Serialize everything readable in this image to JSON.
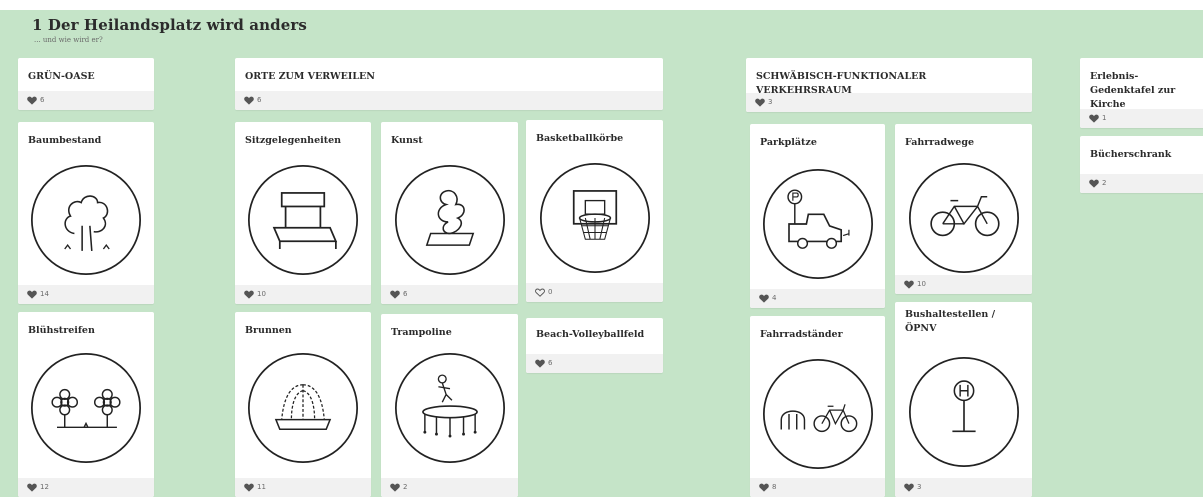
{
  "board": {
    "title": "1 Der Heilandsplatz wird anders",
    "subtitle": "... und wie wird er?"
  },
  "columns": {
    "gruen_oase": {
      "label": "GRÜN-OASE",
      "likes": "6"
    },
    "orte_zum_verweilen": {
      "label": "ORTE ZUM VERWEILEN",
      "likes": "6"
    },
    "verkehrsraum": {
      "label": "SCHWÄBISCH-FUNKTIONALER VERKEHRSRAUM",
      "likes": "3"
    },
    "erlebnis": {
      "label": "Erlebnis-Gedenktafel zur Kirche",
      "likes": "1"
    }
  },
  "cards": {
    "baumbestand": {
      "label": "Baumbestand",
      "likes": "14",
      "icon": "tree-icon"
    },
    "bluehstreifen": {
      "label": "Blühstreifen",
      "likes": "12",
      "icon": "flowers-icon"
    },
    "sitzgelegenheiten": {
      "label": "Sitzgelegenheiten",
      "likes": "10",
      "icon": "bench-icon"
    },
    "kunst": {
      "label": "Kunst",
      "likes": "6",
      "icon": "sculpture-icon"
    },
    "basketballkoerbe": {
      "label": "Basketballkörbe",
      "likes": "0",
      "icon": "basketball-hoop-icon"
    },
    "brunnen": {
      "label": "Brunnen",
      "likes": "11",
      "icon": "fountain-icon"
    },
    "trampoline": {
      "label": "Trampoline",
      "likes": "2",
      "icon": "trampoline-icon"
    },
    "beach_volleyballfeld": {
      "label": "Beach-Volleyballfeld",
      "likes": "6"
    },
    "parkplaetze": {
      "label": "Parkplätze",
      "likes": "4",
      "icon": "parking-car-icon"
    },
    "fahrradwege": {
      "label": "Fahrradwege",
      "likes": "10",
      "icon": "bicycle-icon"
    },
    "fahrradstaender": {
      "label": "Fahrradständer",
      "likes": "8",
      "icon": "bike-rack-icon"
    },
    "bushaltestellen": {
      "label": "Bushaltestellen / ÖPNV",
      "likes": "3",
      "icon": "bus-stop-icon"
    },
    "buecherschrank": {
      "label": "Bücherschrank",
      "likes": "2"
    }
  },
  "colors": {
    "background": "#c5e4c8",
    "card": "#ffffff",
    "footer": "#f1f1f1",
    "heart": "#555555"
  }
}
